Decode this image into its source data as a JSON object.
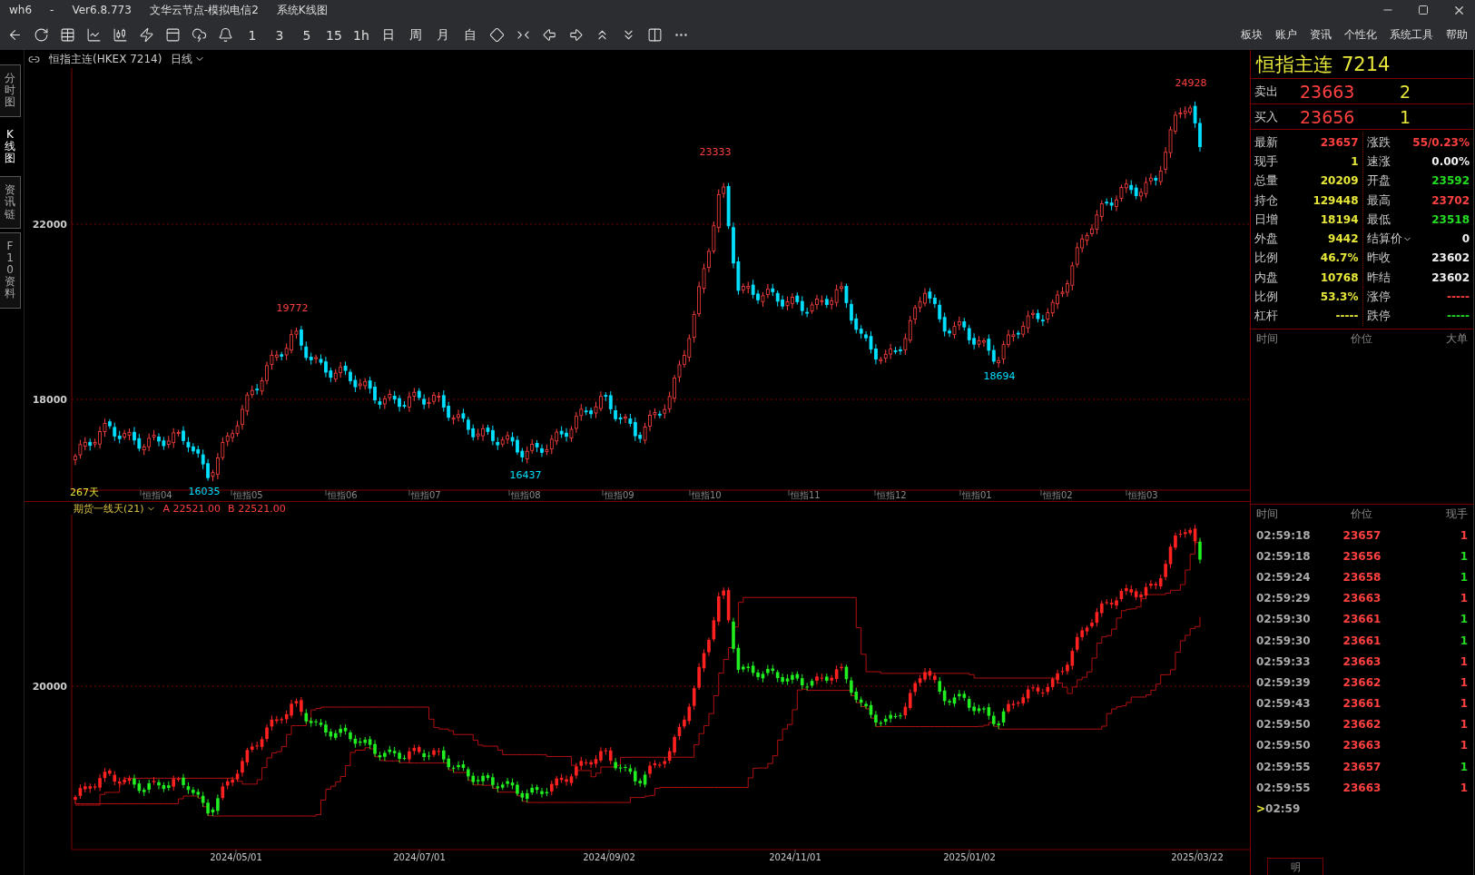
{
  "window": {
    "app": "wh6",
    "separator": "-",
    "version": "Ver6.8.773",
    "server": "文华云节点-模拟电信2",
    "view": "系统K线图"
  },
  "toolbar": {
    "intervals": [
      "1",
      "3",
      "5",
      "15",
      "1h",
      "日",
      "周",
      "月",
      "自"
    ]
  },
  "menu": [
    "板块",
    "账户",
    "资讯",
    "个性化",
    "系统工具",
    "帮助"
  ],
  "side_tabs": [
    {
      "label": "分时图",
      "selected": false
    },
    {
      "label": "K线图",
      "selected": true
    },
    {
      "label": "资讯链",
      "selected": false
    },
    {
      "label": "F10资料",
      "selected": false
    }
  ],
  "chart_header": {
    "symbol": "恒指主连(HKEX 7214)",
    "period": "日线"
  },
  "main_chart": {
    "yticks": [
      "22000",
      "18000"
    ],
    "annotations": [
      {
        "text": "24928",
        "kind": "high"
      },
      {
        "text": "23333",
        "kind": "high"
      },
      {
        "text": "19772",
        "kind": "high"
      },
      {
        "text": "18694",
        "kind": "low"
      },
      {
        "text": "16437",
        "kind": "low"
      },
      {
        "text": "16035",
        "kind": "low"
      }
    ],
    "bars_label": "267天",
    "month_labels": [
      "恒指04",
      "恒指05",
      "恒指06",
      "恒指07",
      "恒指08",
      "恒指09",
      "恒指10",
      "恒指11",
      "恒指12",
      "恒指01",
      "恒指02",
      "恒指03"
    ]
  },
  "indicator": {
    "name": "期货一线天(21)",
    "a": "A 22521.00",
    "b": "B 22521.00",
    "yticks": [
      "20000"
    ],
    "dates": [
      "2024/05/01",
      "2024/07/01",
      "2024/09/02",
      "2024/11/01",
      "2025/01/02",
      "2025/03/22"
    ]
  },
  "quote": {
    "name": "恒指主连",
    "code": "7214",
    "ask": {
      "label": "卖出",
      "price": "23663",
      "volume": "2"
    },
    "bid": {
      "label": "买入",
      "price": "23656",
      "volume": "1"
    },
    "stats": [
      {
        "left": {
          "label": "最新",
          "value": "23657",
          "color": "#ff4040"
        },
        "right": {
          "label": "涨跌",
          "value": "55/0.23%",
          "color": "#ff4040"
        }
      },
      {
        "left": {
          "label": "现手",
          "value": "1",
          "color": "#e8e83a"
        },
        "right": {
          "label": "速涨",
          "value": "0.00%",
          "color": "#f0f0f0"
        }
      },
      {
        "left": {
          "label": "总量",
          "value": "20209",
          "color": "#e8e83a"
        },
        "right": {
          "label": "开盘",
          "value": "23592",
          "color": "#22dd22"
        }
      },
      {
        "left": {
          "label": "持仓",
          "value": "129448",
          "color": "#e8e83a"
        },
        "right": {
          "label": "最高",
          "value": "23702",
          "color": "#ff4040"
        }
      },
      {
        "left": {
          "label": "日增",
          "value": "18194",
          "color": "#e8e83a"
        },
        "right": {
          "label": "最低",
          "value": "23518",
          "color": "#22dd22"
        }
      },
      {
        "left": {
          "label": "外盘",
          "value": "9442",
          "color": "#e8e83a"
        },
        "right": {
          "label": "结算价",
          "value": "0",
          "color": "#f0f0f0",
          "dropdown": true
        }
      },
      {
        "left": {
          "label": "比例",
          "value": "46.7%",
          "color": "#e8e83a"
        },
        "right": {
          "label": "昨收",
          "value": "23602",
          "color": "#f0f0f0"
        }
      },
      {
        "left": {
          "label": "内盘",
          "value": "10768",
          "color": "#e8e83a"
        },
        "right": {
          "label": "昨结",
          "value": "23602",
          "color": "#f0f0f0"
        }
      },
      {
        "left": {
          "label": "比例",
          "value": "53.3%",
          "color": "#e8e83a"
        },
        "right": {
          "label": "涨停",
          "value": "-----",
          "color": "#ff4040"
        }
      },
      {
        "left": {
          "label": "杠杆",
          "value": "-----",
          "color": "#e8e83a"
        },
        "right": {
          "label": "跌停",
          "value": "-----",
          "color": "#22dd22"
        }
      }
    ],
    "big_orders_columns": [
      "时间",
      "价位",
      "大单"
    ]
  },
  "trades": {
    "columns": [
      "时间",
      "价位",
      "现手"
    ],
    "rows": [
      {
        "time": "02:59:18",
        "price": "23657",
        "volume": "1",
        "color": "#ff4040"
      },
      {
        "time": "02:59:18",
        "price": "23656",
        "volume": "1",
        "color": "#22dd22"
      },
      {
        "time": "02:59:24",
        "price": "23658",
        "volume": "1",
        "color": "#22dd22"
      },
      {
        "time": "02:59:29",
        "price": "23663",
        "volume": "1",
        "color": "#ff4040"
      },
      {
        "time": "02:59:30",
        "price": "23661",
        "volume": "1",
        "color": "#22dd22"
      },
      {
        "time": "02:59:30",
        "price": "23661",
        "volume": "1",
        "color": "#22dd22"
      },
      {
        "time": "02:59:33",
        "price": "23663",
        "volume": "1",
        "color": "#ff4040"
      },
      {
        "time": "02:59:39",
        "price": "23662",
        "volume": "1",
        "color": "#ff4040"
      },
      {
        "time": "02:59:43",
        "price": "23661",
        "volume": "1",
        "color": "#ff4040"
      },
      {
        "time": "02:59:50",
        "price": "23662",
        "volume": "1",
        "color": "#ff4040"
      },
      {
        "time": "02:59:50",
        "price": "23663",
        "volume": "1",
        "color": "#ff4040"
      },
      {
        "time": "02:59:55",
        "price": "23657",
        "volume": "1",
        "color": "#22dd22"
      },
      {
        "time": "02:59:55",
        "price": "23663",
        "volume": "1",
        "color": "#ff4040"
      }
    ],
    "partial_row": {
      "marker": ">",
      "time": "02:59"
    },
    "bottom_tab": "明"
  }
}
